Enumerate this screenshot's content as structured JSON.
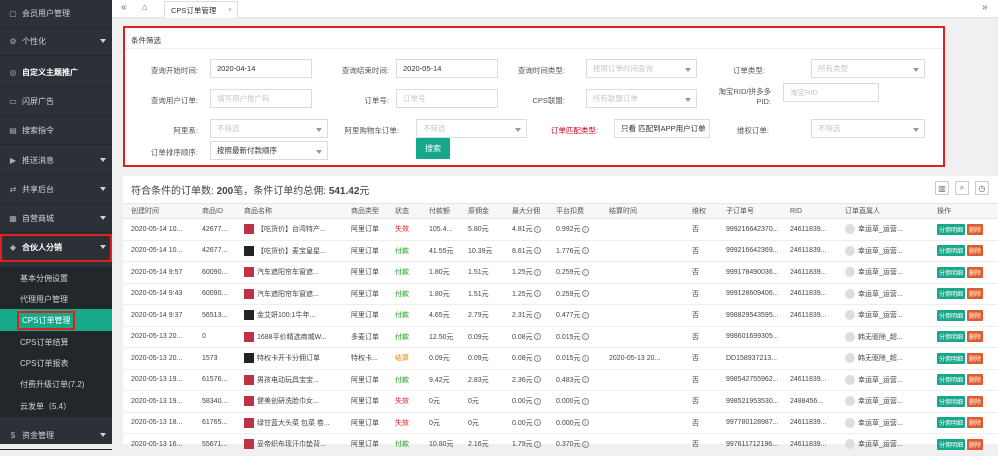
{
  "sidebar": {
    "items": [
      {
        "label": "会员用户管理"
      },
      {
        "label": "个性化"
      },
      {
        "label": "自定义主题推广"
      },
      {
        "label": "闪屏广告"
      },
      {
        "label": "搜索指令"
      },
      {
        "label": "推送消息"
      },
      {
        "label": "共享后台"
      },
      {
        "label": "自营商城"
      },
      {
        "label": "合伙人分销"
      }
    ],
    "subitems": [
      {
        "label": "基本分佣设置"
      },
      {
        "label": "代理用户管理"
      },
      {
        "label": "CPS订单管理"
      },
      {
        "label": "CPS订单结算"
      },
      {
        "label": "CPS订单报表"
      },
      {
        "label": "付费升级订单(7.2)"
      },
      {
        "label": "云发单（5.4）"
      }
    ],
    "last_item": {
      "label": "资金管理"
    }
  },
  "topbar": {
    "collapse_icon": "«",
    "home_icon": "home-icon",
    "tab_label": "CPS订单管理",
    "tab_close": "×",
    "expand_icon": "»"
  },
  "filter": {
    "title": "条件筛选",
    "start_label": "查询开始时间:",
    "start_value": "2020-04-14",
    "end_label": "查询结束时间:",
    "end_value": "2020-05-14",
    "timetype_label": "查询时间类型:",
    "timetype_ph": "按照订单时间查询",
    "ordertype_label": "订单类型:",
    "ordertype_ph": "所有类型",
    "useroder_label": "查询用户订单:",
    "useroder_ph": "填写用户推广码",
    "orderno_label": "订单号:",
    "orderno_ph": "订单号",
    "cpsunion_label": "CPS联盟:",
    "cpsunion_ph": "所有联盟订单",
    "rid_label": "淘宝RID/拼多多PID:",
    "rid_ph": "淘宝RID",
    "ali_label": "阿里系:",
    "ali_ph": "不筛选",
    "alicart_label": "阿里购物车订单:",
    "alicart_ph": "不筛选",
    "match_label": "订单匹配类型:",
    "match_value": "只看 匹配到APP用户订单",
    "rights_label": "维权订单:",
    "rights_ph": "不筛选",
    "sort_label": "订单排序顺序:",
    "sort_value": "按照最新付款顺序",
    "search_button": "搜索"
  },
  "summary": {
    "prefix": "符合条件的订单数: ",
    "count": "200",
    "mid": "笔，条件订单约总佣: ",
    "amount": "541.42",
    "suffix": "元"
  },
  "table": {
    "headers": [
      "创建时间",
      "商品ID",
      "商品名称",
      "商品类型",
      "状态",
      "付款额",
      "原佣金",
      "最大分佣",
      "平台扣费",
      "结算时间",
      "维权",
      "子订单号",
      "RID",
      "订单直属人",
      "操作"
    ],
    "rows": [
      [
        "2020-05-14 10...",
        "42677...",
        "【吃货价】台湾特产...",
        "阿里订单",
        "失效",
        "105.4...",
        "5.80元",
        "4.81元",
        "0.992元",
        "",
        "否",
        "999216642370...",
        "24611839...",
        "幸运草_运营...",
        "",
        ""
      ],
      [
        "2020-05-14 10...",
        "42677...",
        "【吃货价】麦宝皇星...",
        "阿里订单",
        "付款",
        "41.55元",
        "10.39元",
        "8.61元",
        "1.776元",
        "",
        "否",
        "999216642369...",
        "24611839...",
        "幸运草_运营...",
        "",
        ""
      ],
      [
        "2020-05-14 9:57",
        "60090...",
        "汽车遮阳帘车窗遮...",
        "阿里订单",
        "付款",
        "1.80元",
        "1.51元",
        "1.25元",
        "0.259元",
        "",
        "否",
        "999178490036...",
        "24611839...",
        "幸运草_运营...",
        "",
        ""
      ],
      [
        "2020-05-14 9:43",
        "60090...",
        "汽车遮阳帘车窗遮...",
        "阿里订单",
        "付款",
        "1.80元",
        "1.51元",
        "1.25元",
        "0.259元",
        "",
        "否",
        "999128609406...",
        "24611839...",
        "幸运草_运营...",
        "",
        ""
      ],
      [
        "2020-05-14 9:37",
        "56513...",
        "金艾妍100:1牛年...",
        "阿里订单",
        "付款",
        "4.65元",
        "2.79元",
        "2.31元",
        "0.477元",
        "",
        "否",
        "998829543595...",
        "24611839...",
        "幸运草_运营...",
        "",
        ""
      ],
      [
        "2020-05-13 20...",
        "0",
        "1688平价精选商城W...",
        "多麦订单",
        "付款",
        "12.50元",
        "0.09元",
        "0.08元",
        "0.015元",
        "",
        "否",
        "998601699305...",
        "",
        "韩无驱除_超...",
        "",
        ""
      ],
      [
        "2020-05-13 20...",
        "1573",
        "特权卡开卡分佣订单",
        "特权卡...",
        "结算",
        "0.09元",
        "0.09元",
        "0.08元",
        "0.015元",
        "2020-05-13 20...",
        "否",
        "DD158937213...",
        "",
        "韩无驱除_超...",
        "",
        ""
      ],
      [
        "2020-05-13 19...",
        "61576...",
        "男孩电动玩具宝宝...",
        "阿里订单",
        "付款",
        "9.42元",
        "2.83元",
        "2.36元",
        "0.483元",
        "",
        "否",
        "998542755962...",
        "24611839...",
        "幸运草_运营...",
        "",
        ""
      ],
      [
        "2020-05-13 19...",
        "58340...",
        "健美创研洗脸巾女...",
        "阿里订单",
        "失效",
        "0元",
        "0元",
        "0.00元",
        "0.000元",
        "",
        "否",
        "998521953530...",
        "2488456...",
        "幸运草_运营...",
        "",
        ""
      ],
      [
        "2020-05-13 18...",
        "61765...",
        "绿甘蓝大头菜 包菜 卷...",
        "阿里订单",
        "失效",
        "0元",
        "0元",
        "0.00元",
        "0.000元",
        "",
        "否",
        "997780128987...",
        "24611839...",
        "幸运草_运营...",
        "",
        ""
      ],
      [
        "2020-05-13 16...",
        "55671...",
        "妥帝织布现汗巾垫背...",
        "阿里订单",
        "付款",
        "10.80元",
        "2.16元",
        "1.79元",
        "0.370元",
        "",
        "否",
        "997611712196...",
        "24611839...",
        "幸运草_运营...",
        "",
        ""
      ]
    ],
    "btn_detail": "分佣明细",
    "btn_delete": "删除"
  },
  "colors": {
    "accent": "#17a88b",
    "highlight": "#e02020",
    "sidebar_bg": "#2b3136"
  }
}
